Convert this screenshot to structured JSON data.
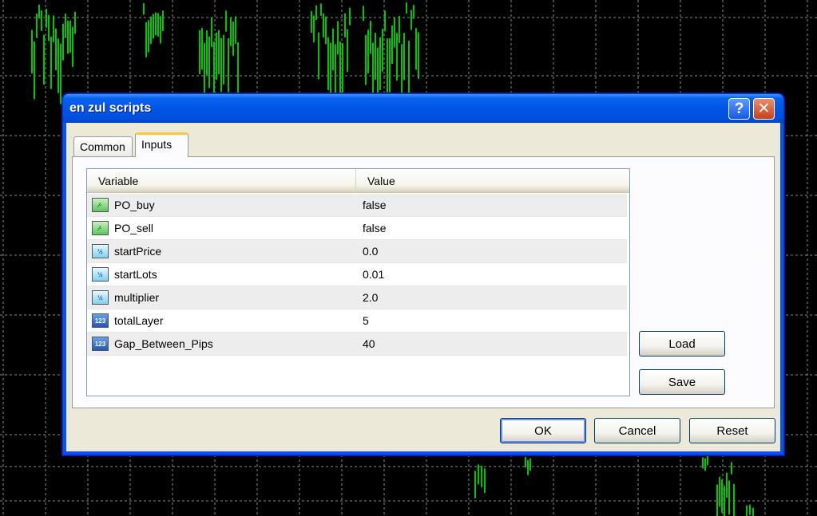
{
  "window": {
    "title": "en zul scripts",
    "help_glyph": "?",
    "close_glyph": "✕"
  },
  "tabs": [
    {
      "label": "Common",
      "active": false
    },
    {
      "label": "Inputs",
      "active": true
    }
  ],
  "table": {
    "columns": [
      "Variable",
      "Value"
    ],
    "rows": [
      {
        "icon": "bool-type-icon",
        "type_glyph": "⁄·",
        "variable": "PO_buy",
        "value": "false"
      },
      {
        "icon": "bool-type-icon",
        "type_glyph": "⁄·",
        "variable": "PO_sell",
        "value": "false"
      },
      {
        "icon": "double-type-icon",
        "type_glyph": "½",
        "variable": "startPrice",
        "value": "0.0"
      },
      {
        "icon": "double-type-icon",
        "type_glyph": "½",
        "variable": "startLots",
        "value": "0.01"
      },
      {
        "icon": "double-type-icon",
        "type_glyph": "½",
        "variable": "multiplier",
        "value": "2.0"
      },
      {
        "icon": "int-type-icon",
        "type_glyph": "123",
        "variable": "totalLayer",
        "value": "5"
      },
      {
        "icon": "int-type-icon",
        "type_glyph": "123",
        "variable": "Gap_Between_Pips",
        "value": "40"
      }
    ]
  },
  "side_buttons": {
    "load": "Load",
    "save": "Save"
  },
  "footer_buttons": {
    "ok": "OK",
    "cancel": "Cancel",
    "reset": "Reset"
  },
  "colors": {
    "title_bar": "#0055e5",
    "chart_background": "#000000",
    "chart_candles": "#00c800",
    "chart_grid": "#8a8a8a"
  }
}
